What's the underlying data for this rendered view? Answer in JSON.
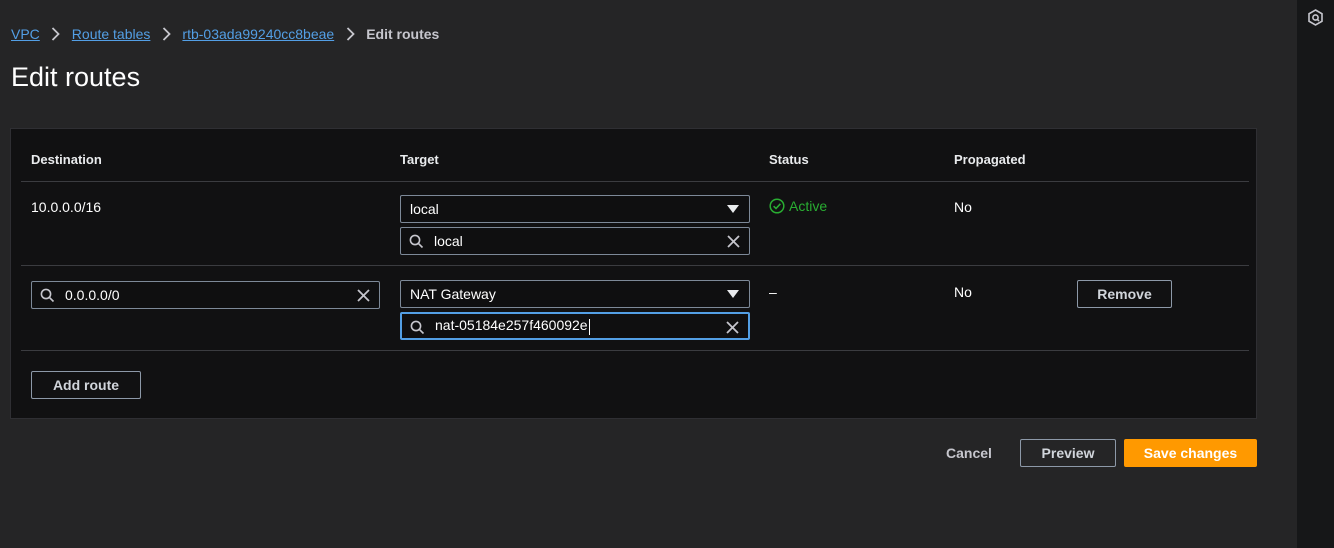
{
  "breadcrumb": {
    "items": [
      "VPC",
      "Route tables",
      "rtb-03ada99240cc8beae"
    ],
    "current": "Edit routes"
  },
  "page": {
    "title": "Edit routes"
  },
  "table": {
    "columns": {
      "destination": "Destination",
      "target": "Target",
      "status": "Status",
      "propagated": "Propagated"
    },
    "rows": [
      {
        "destination": "10.0.0.0/16",
        "target_select": "local",
        "target_search": "local",
        "status": "Active",
        "propagated": "No"
      },
      {
        "destination_search": "0.0.0.0/0",
        "target_select": "NAT Gateway",
        "target_search": "nat-05184e257f460092e",
        "status": "–",
        "propagated": "No",
        "remove_label": "Remove"
      }
    ],
    "add_route_label": "Add route"
  },
  "footer": {
    "cancel_label": "Cancel",
    "preview_label": "Preview",
    "save_label": "Save changes"
  },
  "colors": {
    "accent": "#ff9900",
    "link": "#539fe5",
    "status_active": "#29ad32",
    "background": "#252526",
    "panel": "#111112"
  }
}
